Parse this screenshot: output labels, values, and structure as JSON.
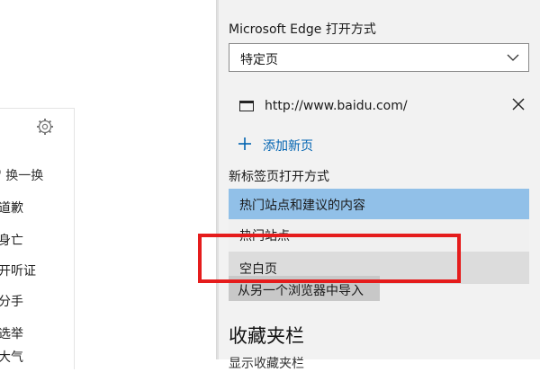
{
  "left": {
    "icon": "gear-icon",
    "items": [
      "' 换一换",
      "道歉",
      "身亡",
      "开听证",
      "分手",
      "选举",
      "大气"
    ]
  },
  "settings": {
    "open_with_label": "Microsoft Edge 打开方式",
    "open_with_value": "特定页",
    "page_url": "http://www.baidu.com/",
    "add_page_label": "添加新页",
    "new_tab_label": "新标签页打开方式",
    "new_tab_options": [
      "热门站点和建议的内容",
      "热门站点",
      "空白页"
    ],
    "new_tab_selected_index": 0,
    "import_label": "从另一个浏览器中导入",
    "favorites_title": "收藏夹栏",
    "cutoff_text": "显示收藏夹栏"
  },
  "colors": {
    "accent": "#0063b1",
    "selected_option": "#91c0e8",
    "highlight_box": "#e51c1c",
    "pane_background": "#f2f2f2"
  }
}
